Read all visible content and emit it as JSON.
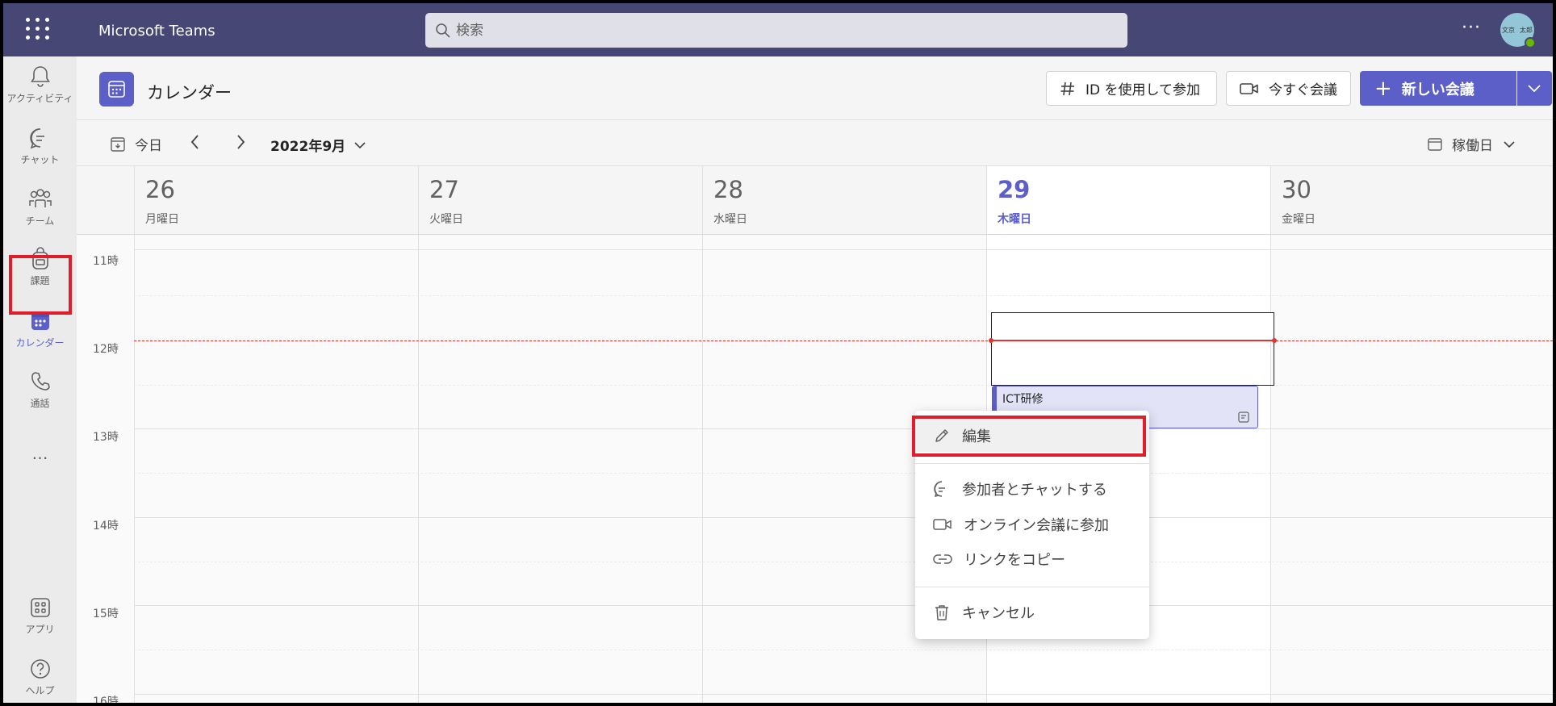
{
  "app": {
    "title": "Microsoft Teams",
    "search_placeholder": "検索",
    "avatar_text": [
      "文京",
      "太郎"
    ],
    "accent": "#5b5fc7",
    "header_color": "#464775",
    "highlight_color": "#e01e2b"
  },
  "rail": {
    "items": [
      {
        "label": "アクティビティ",
        "icon": "bell-icon"
      },
      {
        "label": "チャット",
        "icon": "chat-icon"
      },
      {
        "label": "チーム",
        "icon": "teams-icon"
      },
      {
        "label": "課題",
        "icon": "backpack-icon"
      },
      {
        "label": "カレンダー",
        "icon": "calendar-icon"
      },
      {
        "label": "通話",
        "icon": "phone-icon"
      }
    ],
    "more": "…",
    "bottom_items": [
      {
        "label": "アプリ",
        "icon": "apps-icon"
      },
      {
        "label": "ヘルプ",
        "icon": "help-icon"
      }
    ]
  },
  "header": {
    "title": "カレンダー",
    "join_id_label": "ID を使用して参加",
    "meet_now_label": "今すぐ会議",
    "new_meeting_label": "新しい会議"
  },
  "nav": {
    "today_label": "今日",
    "month_label": "2022年9月",
    "view_label": "稼働日"
  },
  "days": [
    {
      "num": "26",
      "name": "月曜日"
    },
    {
      "num": "27",
      "name": "火曜日"
    },
    {
      "num": "28",
      "name": "水曜日"
    },
    {
      "num": "29",
      "name": "木曜日"
    },
    {
      "num": "30",
      "name": "金曜日"
    }
  ],
  "hours": [
    "11時",
    "12時",
    "13時",
    "14時",
    "15時",
    "16時"
  ],
  "event": {
    "title": "ICT研修"
  },
  "menu": {
    "edit": "編集",
    "chat": "参加者とチャットする",
    "join": "オンライン会議に参加",
    "copy": "リンクをコピー",
    "cancel": "キャンセル"
  }
}
